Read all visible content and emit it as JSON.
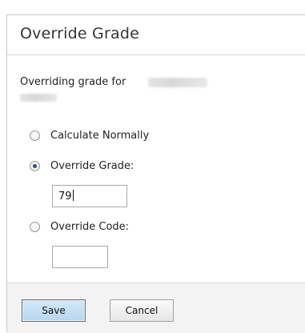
{
  "dialog": {
    "title": "Override Grade",
    "intro": "Overriding grade for"
  },
  "options": [
    {
      "label": "Calculate Normally",
      "checked": false
    },
    {
      "label": "Override Grade:",
      "checked": true
    },
    {
      "label": "Override Code:",
      "checked": false
    }
  ],
  "grade_input": {
    "value": "79"
  },
  "code_input": {
    "value": ""
  },
  "footer": {
    "save_label": "Save",
    "cancel_label": "Cancel"
  }
}
